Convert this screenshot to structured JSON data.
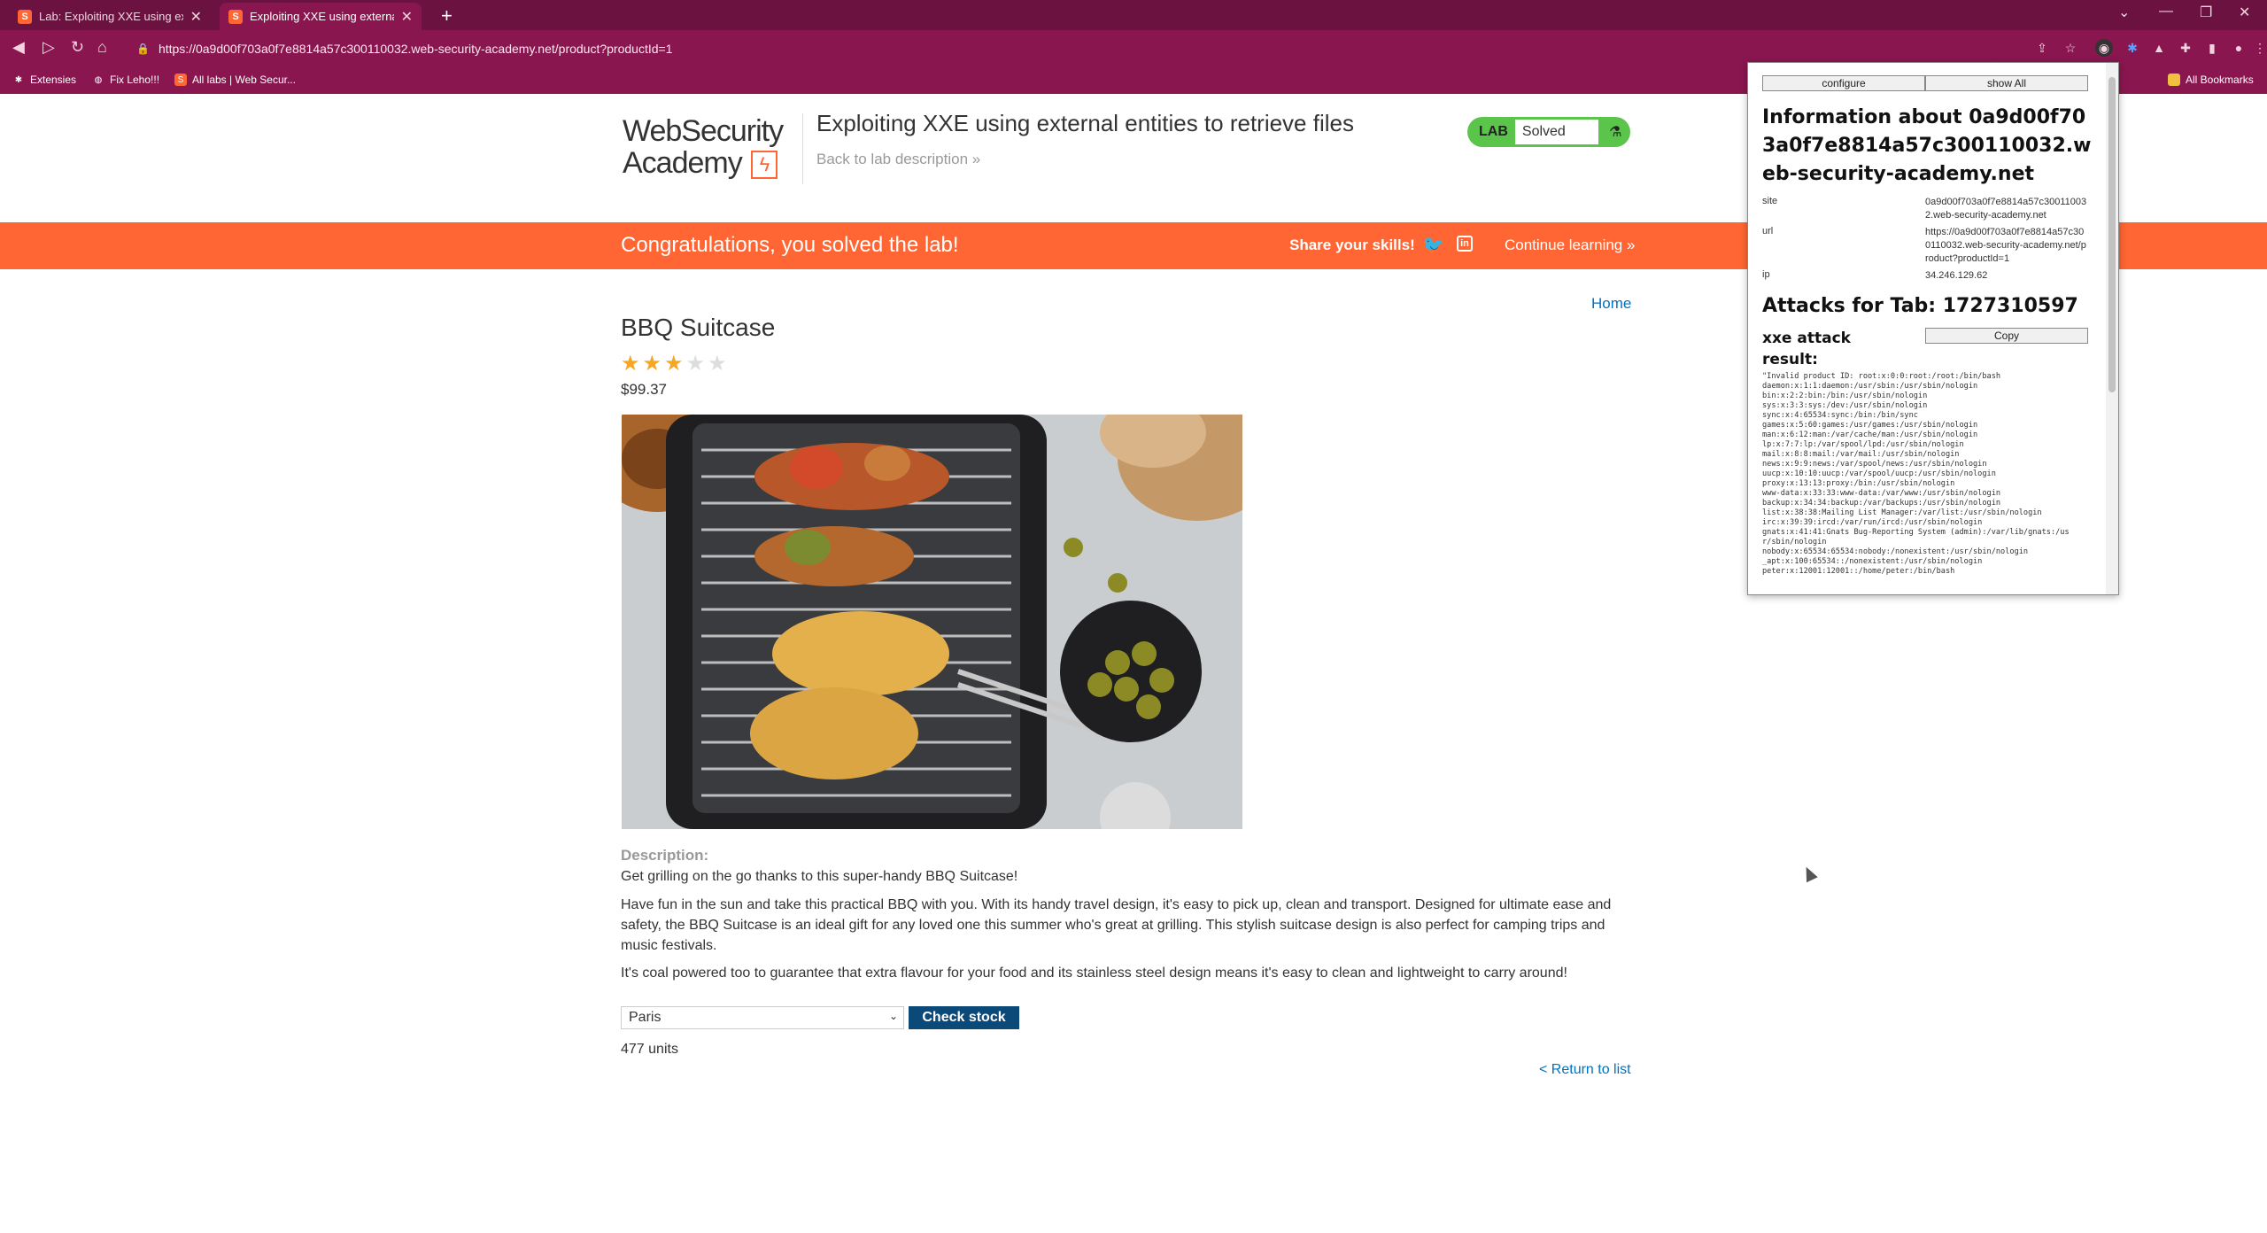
{
  "browser": {
    "tabs": [
      {
        "title": "Lab: Exploiting XXE using extern",
        "favicon": "S"
      },
      {
        "title": "Exploiting XXE using external en",
        "favicon": "S"
      }
    ],
    "url": "https://0a9d00f703a0f7e8814a57c300110032.web-security-academy.net/product?productId=1",
    "bookmarks": [
      {
        "label": "Extensies",
        "icon": "puzzle-icon"
      },
      {
        "label": "Fix Leho!!!",
        "icon": "globe-icon"
      },
      {
        "label": "All labs | Web Secur...",
        "icon": "portswigger-icon"
      }
    ],
    "all_bookmarks": "All Bookmarks"
  },
  "lab": {
    "logo_line1": "WebSecurity",
    "logo_line2": "Academy",
    "title": "Exploiting XXE using external entities to retrieve files",
    "back_link": "Back to lab description",
    "badge_lab": "LAB",
    "badge_status": "Solved"
  },
  "banner": {
    "message": "Congratulations, you solved the lab!",
    "share": "Share your skills!",
    "continue": "Continue learning"
  },
  "product": {
    "home": "Home",
    "title": "BBQ Suitcase",
    "rating": 3,
    "rating_max": 5,
    "price": "$99.37",
    "description_label": "Description:",
    "p1": "Get grilling on the go thanks to this super-handy BBQ Suitcase!",
    "p2": "Have fun in the sun and take this practical BBQ with you. With its handy travel design, it's easy to pick up, clean and transport. Designed for ultimate ease and safety, the BBQ Suitcase is an ideal gift for any loved one this summer who's great at grilling. This stylish suitcase design is also perfect for camping trips and music festivals.",
    "p3": "It's coal powered too to guarantee that extra flavour for your food and its stainless steel design means it's easy to clean and lightweight to carry around!",
    "store_selected": "Paris",
    "check_stock": "Check stock",
    "units": "477 units",
    "return": "< Return to list"
  },
  "popup": {
    "configure": "configure",
    "show_all": "show All",
    "info_heading": "Information about 0a9d00f703a0f7e8814a57c300110032.web-security-academy.net",
    "site_label": "site",
    "site_value": "0a9d00f703a0f7e8814a57c300110032.web-security-academy.net",
    "url_label": "url",
    "url_value": "https://0a9d00f703a0f7e8814a57c300110032.web-security-academy.net/product?productId=1",
    "ip_label": "ip",
    "ip_value": "34.246.129.62",
    "attacks_heading": "Attacks for Tab: 1727310597",
    "attack_name": "xxe attack",
    "copy": "Copy",
    "result_label": "result:",
    "result_text": "\"Invalid product ID: root:x:0:0:root:/root:/bin/bash\ndaemon:x:1:1:daemon:/usr/sbin:/usr/sbin/nologin\nbin:x:2:2:bin:/bin:/usr/sbin/nologin\nsys:x:3:3:sys:/dev:/usr/sbin/nologin\nsync:x:4:65534:sync:/bin:/bin/sync\ngames:x:5:60:games:/usr/games:/usr/sbin/nologin\nman:x:6:12:man:/var/cache/man:/usr/sbin/nologin\nlp:x:7:7:lp:/var/spool/lpd:/usr/sbin/nologin\nmail:x:8:8:mail:/var/mail:/usr/sbin/nologin\nnews:x:9:9:news:/var/spool/news:/usr/sbin/nologin\nuucp:x:10:10:uucp:/var/spool/uucp:/usr/sbin/nologin\nproxy:x:13:13:proxy:/bin:/usr/sbin/nologin\nwww-data:x:33:33:www-data:/var/www:/usr/sbin/nologin\nbackup:x:34:34:backup:/var/backups:/usr/sbin/nologin\nlist:x:38:38:Mailing List Manager:/var/list:/usr/sbin/nologin\nirc:x:39:39:ircd:/var/run/ircd:/usr/sbin/nologin\ngnats:x:41:41:Gnats Bug-Reporting System (admin):/var/lib/gnats:/us\nr/sbin/nologin\nnobody:x:65534:65534:nobody:/nonexistent:/usr/sbin/nologin\n_apt:x:100:65534::/nonexistent:/usr/sbin/nologin\npeter:x:12001:12001::/home/peter:/bin/bash"
  },
  "colors": {
    "tabbar": "#6b1240",
    "toolbar": "#8a1650",
    "banner": "#ff6633",
    "badge": "#5bc44b",
    "link": "#0071bc",
    "check_button": "#0b4a78",
    "star_filled": "#f5a623",
    "star_empty": "#dddddd"
  }
}
